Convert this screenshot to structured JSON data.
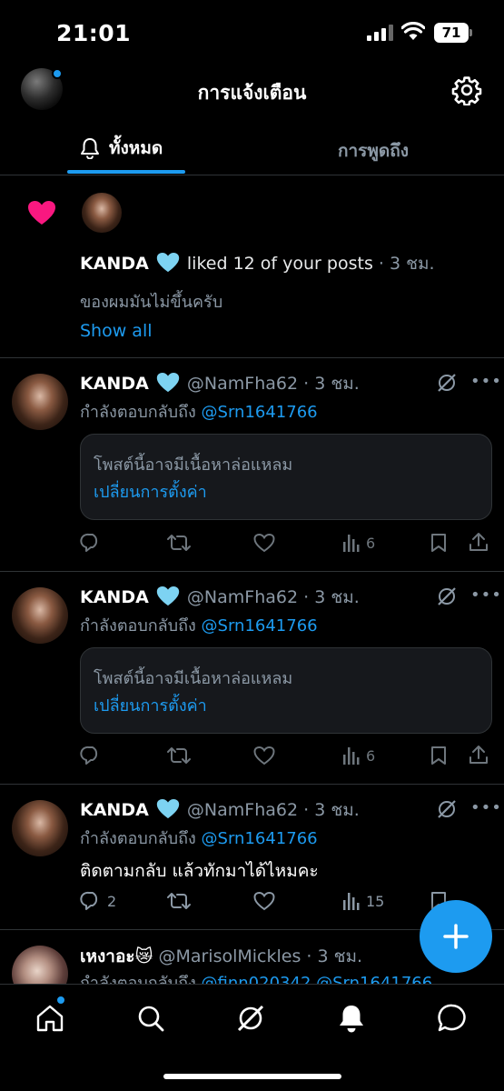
{
  "status_bar": {
    "time": "21:01",
    "battery": "71"
  },
  "header": {
    "title": "การแจ้งเตือน"
  },
  "tabs": [
    {
      "label": "ทั้งหมด",
      "active": true
    },
    {
      "label": "การพูดถึง",
      "active": false
    }
  ],
  "like_notification": {
    "name": "KANDA",
    "action": "liked 12 of your posts",
    "time": "· 3 ชม.",
    "post_snippet": "ของผมมันไม่ขึ้นครับ",
    "show_all": "Show all"
  },
  "posts": [
    {
      "name": "KANDA",
      "handle": "@NamFha62",
      "time": "· 3 ชม.",
      "reply_prefix": "กำลังตอบกลับถึง",
      "reply_mention": "@Srn1641766",
      "warning": "โพสต์นี้อาจมีเนื้อหาล่อแหลม",
      "warning_link": "เปลี่ยนการตั้งค่า",
      "replies": "",
      "views": "6"
    },
    {
      "name": "KANDA",
      "handle": "@NamFha62",
      "time": "· 3 ชม.",
      "reply_prefix": "กำลังตอบกลับถึง",
      "reply_mention": "@Srn1641766",
      "warning": "โพสต์นี้อาจมีเนื้อหาล่อแหลม",
      "warning_link": "เปลี่ยนการตั้งค่า",
      "replies": "",
      "views": "6"
    },
    {
      "name": "KANDA",
      "handle": "@NamFha62",
      "time": "· 3 ชม.",
      "reply_prefix": "กำลังตอบกลับถึง",
      "reply_mention": "@Srn1641766",
      "text": "ติดตามกลับ แล้วทักมาได้ไหมคะ",
      "replies": "2",
      "views": "15"
    },
    {
      "name": "เหงาอะ😿",
      "handle": "@MarisolMickles",
      "time": "· 3 ชม.",
      "reply_prefix": "กำลังตอบกลับถึง",
      "reply_mention": "@finn020342 @Srn1641766"
    }
  ],
  "icons": {
    "heart": "heart-icon",
    "verified": "verified-heart-icon",
    "settings": "gear-icon",
    "bell": "bell-icon",
    "nav": [
      "home-icon",
      "search-icon",
      "grok-icon",
      "bell-icon",
      "messages-icon"
    ]
  },
  "colors": {
    "accent": "#1d9bf0",
    "like": "#f91880",
    "verified": "#7dd3f2",
    "background": "#000000"
  }
}
